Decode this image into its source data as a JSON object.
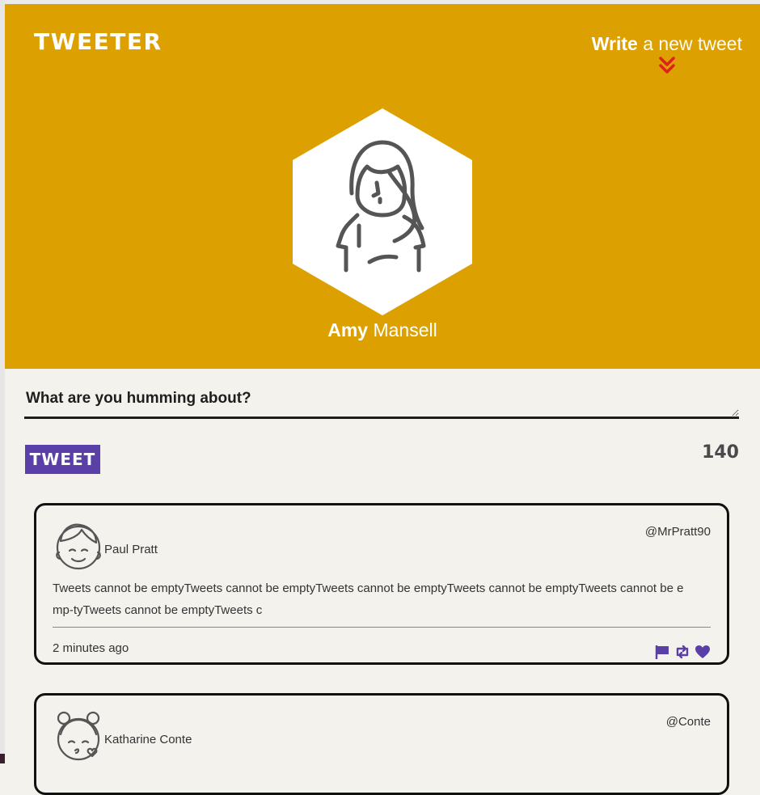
{
  "header": {
    "logo": "TWEETER",
    "compose_toggle": {
      "strong": "Write",
      "light": "a new tweet"
    },
    "accent": "#dca000"
  },
  "profile": {
    "first_name": "Amy",
    "last_name": "Mansell"
  },
  "compose": {
    "placeholder": "What are you humming about?",
    "button_label": "TWEET",
    "counter": "140"
  },
  "tweets": [
    {
      "name": "Paul Pratt",
      "handle": "@MrPratt90",
      "text": "Tweets cannot be emptyTweets cannot be emptyTweets cannot be emptyTweets cannot be emptyTweets cannot be emp-tyTweets cannot be emptyTweets c",
      "time": "2 minutes ago",
      "actions": [
        "flag-icon",
        "retweet-icon",
        "heart-icon"
      ]
    },
    {
      "name": "Katharine Conte",
      "handle": "@Conte"
    }
  ],
  "colors": {
    "button": "#5a3fa8",
    "icons": "#5a3fa8",
    "chevron": "#e02020"
  }
}
